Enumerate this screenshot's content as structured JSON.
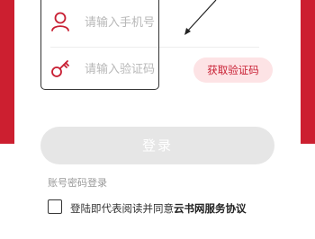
{
  "colors": {
    "primary": "#cc1f30",
    "code_button_bg": "#fde3e5"
  },
  "phone": {
    "icon": "user-icon",
    "placeholder": "请输入手机号"
  },
  "code": {
    "icon": "key-icon",
    "placeholder": "请输入验证码",
    "send_label": "获取验证码"
  },
  "login": {
    "label": "登录"
  },
  "password_login": "账号密码登录",
  "agreement": {
    "prefix": "登陆即代表阅读并同意",
    "link": "云书网服务协议",
    "checked": false
  }
}
